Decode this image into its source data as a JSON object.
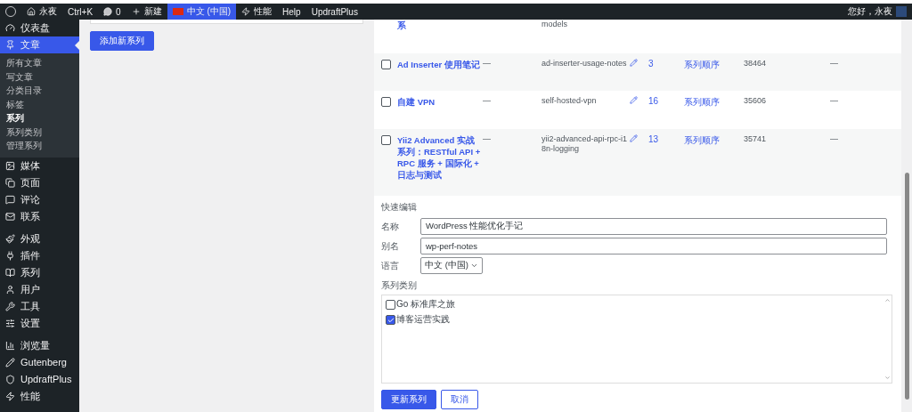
{
  "admin_bar": {
    "site": "永夜",
    "shortcut": "Ctrl+K",
    "comments": "0",
    "new": "新建",
    "language": "中文 (中国)",
    "language_selected": true,
    "performance": "性能",
    "help": "Help",
    "backup": "UpdraftPlus",
    "greeting": "您好，永夜"
  },
  "sidebar": {
    "items": [
      {
        "label": "仪表盘",
        "selected": false
      },
      {
        "label": "文章",
        "selected": true,
        "children": [
          {
            "label": "所有文章",
            "selected": false
          },
          {
            "label": "写文章",
            "selected": false
          },
          {
            "label": "分类目录",
            "selected": false
          },
          {
            "label": "标签",
            "selected": false
          },
          {
            "label": "系列",
            "selected": true
          },
          {
            "label": "系列类别",
            "selected": false
          },
          {
            "label": "管理系列",
            "selected": false
          }
        ]
      },
      {
        "label": "媒体",
        "selected": false
      },
      {
        "label": "页面",
        "selected": false
      },
      {
        "label": "评论",
        "selected": false
      },
      {
        "label": "联系",
        "selected": false
      },
      {
        "label": "外观",
        "selected": false
      },
      {
        "label": "插件",
        "selected": false
      },
      {
        "label": "系列",
        "selected": false
      },
      {
        "label": "用户",
        "selected": false
      },
      {
        "label": "工具",
        "selected": false
      },
      {
        "label": "设置",
        "selected": false
      },
      {
        "label": "浏览量",
        "selected": false
      },
      {
        "label": "Gutenberg",
        "selected": false
      },
      {
        "label": "UpdraftPlus",
        "selected": false
      },
      {
        "label": "性能",
        "selected": false
      }
    ]
  },
  "add_form": {
    "button": "添加新系列"
  },
  "table": {
    "rows": [
      {
        "kind": "partial",
        "title": "系",
        "slug": "models"
      },
      {
        "kind": "full",
        "checked": false,
        "title": "Ad Inserter 使用笔记",
        "description": "—",
        "slug": "ad-inserter-usage-notes",
        "count": "3",
        "order": "系列顺序",
        "id": "38464",
        "column_9": "—"
      },
      {
        "kind": "full",
        "checked": false,
        "title": "自建 VPN",
        "description": "—",
        "slug": "self-hosted-vpn",
        "count": "16",
        "order": "系列顺序",
        "id": "35606",
        "column_9": "—"
      },
      {
        "kind": "full",
        "checked": false,
        "title": "Yii2 Advanced 实战系列：RESTful API + RPC 服务 + 国际化 + 日志与测试",
        "description": "—",
        "slug": "yii2-advanced-api-rpc-i18n-logging",
        "count": "13",
        "order": "系列顺序",
        "id": "35741",
        "column_9": "—"
      }
    ]
  },
  "quick_edit": {
    "title": "快速编辑",
    "name_label": "名称",
    "name_value": "WordPress 性能优化手记",
    "slug_label": "别名",
    "slug_value": "wp-perf-notes",
    "language_label": "语言",
    "language_value": "中文 (中国)",
    "categories_label": "系列类别",
    "categories": [
      {
        "label": "Go 标准库之旅",
        "checked": false
      },
      {
        "label": "博客运营实践",
        "checked": true
      }
    ],
    "update_button": "更新系列",
    "cancel_button": "取消"
  }
}
